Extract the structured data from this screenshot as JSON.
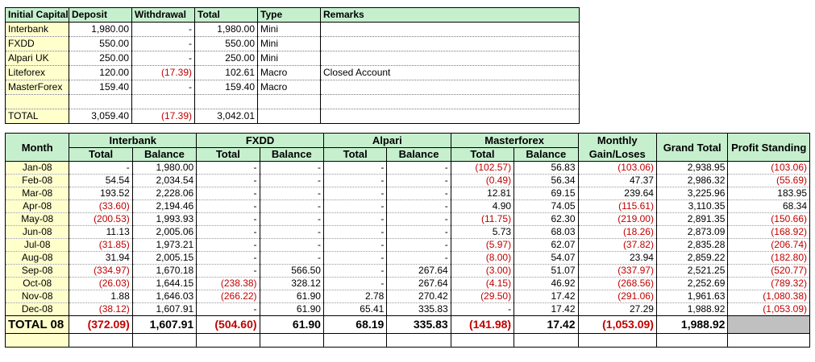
{
  "summary": {
    "headers": [
      "Initial Capital",
      "Deposit",
      "Withdrawal",
      "Total",
      "Type",
      "Remarks"
    ],
    "rows": [
      {
        "name": "Interbank",
        "deposit": "1,980.00",
        "withdrawal": "-",
        "total": "1,980.00",
        "type": "Mini",
        "remarks": ""
      },
      {
        "name": "FXDD",
        "deposit": "550.00",
        "withdrawal": "-",
        "total": "550.00",
        "type": "Mini",
        "remarks": ""
      },
      {
        "name": "Alpari UK",
        "deposit": "250.00",
        "withdrawal": "-",
        "total": "250.00",
        "type": "Mini",
        "remarks": ""
      },
      {
        "name": "Liteforex",
        "deposit": "120.00",
        "withdrawal": "(17.39)",
        "total": "102.61",
        "type": "Macro",
        "remarks": "Closed Account"
      },
      {
        "name": "MasterForex",
        "deposit": "159.40",
        "withdrawal": "-",
        "total": "159.40",
        "type": "Macro",
        "remarks": ""
      },
      {
        "name": "",
        "deposit": "",
        "withdrawal": "",
        "total": "",
        "type": "",
        "remarks": ""
      },
      {
        "name": "TOTAL",
        "deposit": "3,059.40",
        "withdrawal": "(17.39)",
        "total": "3,042.01",
        "type": "",
        "remarks": ""
      }
    ]
  },
  "monthly": {
    "headers": {
      "month": "Month",
      "brokers": [
        "Interbank",
        "FXDD",
        "Alpari",
        "Masterforex"
      ],
      "sub_total": "Total",
      "sub_balance": "Balance",
      "gain": "Monthly Gain/Loses",
      "grand": "Grand Total",
      "profit": "Profit Standing"
    },
    "rows": [
      [
        "Jan-08",
        "-",
        "1,980.00",
        "-",
        "-",
        "-",
        "-",
        "(102.57)",
        "56.83",
        "(103.06)",
        "2,938.95",
        "(103.06)"
      ],
      [
        "Feb-08",
        "54.54",
        "2,034.54",
        "-",
        "-",
        "-",
        "-",
        "(0.49)",
        "56.34",
        "47.37",
        "2,986.32",
        "(55.69)"
      ],
      [
        "Mar-08",
        "193.52",
        "2,228.06",
        "-",
        "-",
        "-",
        "-",
        "12.81",
        "69.15",
        "239.64",
        "3,225.96",
        "183.95"
      ],
      [
        "Apr-08",
        "(33.60)",
        "2,194.46",
        "-",
        "-",
        "-",
        "-",
        "4.90",
        "74.05",
        "(115.61)",
        "3,110.35",
        "68.34"
      ],
      [
        "May-08",
        "(200.53)",
        "1,993.93",
        "-",
        "-",
        "-",
        "-",
        "(11.75)",
        "62.30",
        "(219.00)",
        "2,891.35",
        "(150.66)"
      ],
      [
        "Jun-08",
        "11.13",
        "2,005.06",
        "-",
        "-",
        "-",
        "-",
        "5.73",
        "68.03",
        "(18.26)",
        "2,873.09",
        "(168.92)"
      ],
      [
        "Jul-08",
        "(31.85)",
        "1,973.21",
        "-",
        "-",
        "-",
        "-",
        "(5.97)",
        "62.07",
        "(37.82)",
        "2,835.28",
        "(206.74)"
      ],
      [
        "Aug-08",
        "31.94",
        "2,005.15",
        "-",
        "-",
        "-",
        "-",
        "(8.00)",
        "54.07",
        "23.94",
        "2,859.22",
        "(182.80)"
      ],
      [
        "Sep-08",
        "(334.97)",
        "1,670.18",
        "-",
        "566.50",
        "-",
        "267.64",
        "(3.00)",
        "51.07",
        "(337.97)",
        "2,521.25",
        "(520.77)"
      ],
      [
        "Oct-08",
        "(26.03)",
        "1,644.15",
        "(238.38)",
        "328.12",
        "-",
        "267.64",
        "(4.15)",
        "46.92",
        "(268.56)",
        "2,252.69",
        "(789.32)"
      ],
      [
        "Nov-08",
        "1.88",
        "1,646.03",
        "(266.22)",
        "61.90",
        "2.78",
        "270.42",
        "(29.50)",
        "17.42",
        "(291.06)",
        "1,961.63",
        "(1,080.38)"
      ],
      [
        "Dec-08",
        "(38.12)",
        "1,607.91",
        "-",
        "61.90",
        "65.41",
        "335.83",
        "-",
        "17.42",
        "27.29",
        "1,988.92",
        "(1,053.09)"
      ]
    ],
    "total": [
      "TOTAL 08",
      "(372.09)",
      "1,607.91",
      "(504.60)",
      "61.90",
      "68.19",
      "335.83",
      "(141.98)",
      "17.42",
      "(1,053.09)",
      "1,988.92",
      ""
    ]
  }
}
